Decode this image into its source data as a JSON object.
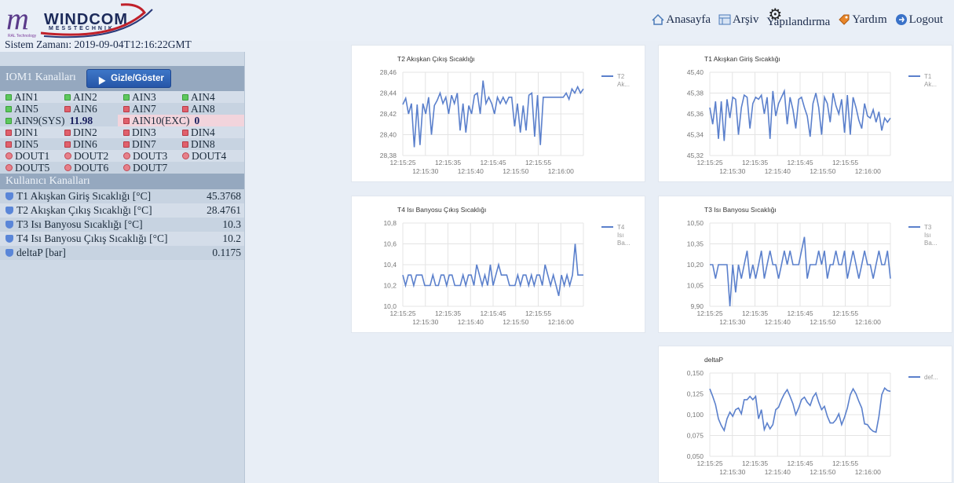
{
  "header": {
    "brand": "WINDCOM",
    "brand_sub": "MESSTECHNIK",
    "brand_tiny": "RAL Technology",
    "brand_mono": "m",
    "nav": [
      {
        "label": "Anasayfa",
        "icon": "home-icon"
      },
      {
        "label": "Arşiv",
        "icon": "archive-icon"
      },
      {
        "label": "Yapılandırma",
        "icon": "gear-icon"
      },
      {
        "label": "Yardım",
        "icon": "help-icon"
      },
      {
        "label": "Logout",
        "icon": "logout-icon"
      }
    ]
  },
  "system_time": "Sistem Zamanı: 2019-09-04T12:16:22GMT",
  "iom": {
    "title": "IOM1 Kanalları",
    "toggle_label": "Gizle/Göster",
    "rows": [
      [
        {
          "label": "AIN1",
          "ind": "green"
        },
        {
          "label": "AIN2",
          "ind": "green"
        },
        {
          "label": "AIN3",
          "ind": "green"
        },
        {
          "label": "AIN4",
          "ind": "green"
        }
      ],
      [
        {
          "label": "AIN5",
          "ind": "green"
        },
        {
          "label": "AIN6",
          "ind": "red"
        },
        {
          "label": "AIN7",
          "ind": "red"
        },
        {
          "label": "AIN8",
          "ind": "red"
        }
      ],
      [
        {
          "label": "DIN1",
          "ind": "red"
        },
        {
          "label": "DIN2",
          "ind": "red"
        },
        {
          "label": "DIN3",
          "ind": "red"
        },
        {
          "label": "DIN4",
          "ind": "red"
        }
      ],
      [
        {
          "label": "DIN5",
          "ind": "red"
        },
        {
          "label": "DIN6",
          "ind": "red"
        },
        {
          "label": "DIN7",
          "ind": "red"
        },
        {
          "label": "DIN8",
          "ind": "red"
        }
      ],
      [
        {
          "label": "DOUT1",
          "ind": "circ"
        },
        {
          "label": "DOUT2",
          "ind": "circ"
        },
        {
          "label": "DOUT3",
          "ind": "circ"
        },
        {
          "label": "DOUT4",
          "ind": "circ"
        }
      ],
      [
        {
          "label": "DOUT5",
          "ind": "circ"
        },
        {
          "label": "DOUT6",
          "ind": "circ"
        },
        {
          "label": "DOUT7",
          "ind": "circ"
        }
      ]
    ],
    "ain9_label": "AIN9(SYS)",
    "ain9_value": "11.98",
    "ain10_label": "AIN10(EXC)",
    "ain10_value": "0"
  },
  "user_channels": {
    "title": "Kullanıcı Kanalları",
    "items": [
      {
        "label": "T1 Akışkan Giriş Sıcaklığı [°C]",
        "value": "45.3768"
      },
      {
        "label": "T2 Akışkan Çıkış Sıcaklığı [°C]",
        "value": "28.4761"
      },
      {
        "label": "T3 Isı Banyosu Sıcaklığı [°C]",
        "value": "10.3"
      },
      {
        "label": "T4 Isı Banyosu Çıkış Sıcaklığı [°C]",
        "value": "10.2"
      },
      {
        "label": "deltaP [bar]",
        "value": "0.1175"
      }
    ]
  },
  "colors": {
    "line": "#5b80cc",
    "grid": "#e4e4e4"
  },
  "chart_data": [
    {
      "type": "line",
      "title": "T2 Akışkan Çıkış Sıcaklığı",
      "legend": [
        "T2",
        "Ak..."
      ],
      "yticks": [
        "28,46",
        "28,44",
        "28,42",
        "28,40",
        "28,38"
      ],
      "ylim": [
        28.38,
        28.46
      ],
      "xticks_top": [
        "12:15:25",
        "12:15:35",
        "12:15:45",
        "12:15:55"
      ],
      "xticks_bottom": [
        "12:15:30",
        "12:15:40",
        "12:15:50",
        "12:16:00"
      ],
      "series": [
        {
          "values": [
            28.429,
            28.435,
            28.42,
            28.43,
            28.388,
            28.429,
            28.39,
            28.43,
            28.42,
            28.436,
            28.4,
            28.428,
            28.433,
            28.44,
            28.43,
            28.436,
            28.42,
            28.438,
            28.43,
            28.44,
            28.404,
            28.43,
            28.402,
            28.428,
            28.42,
            28.438,
            28.44,
            28.42,
            28.452,
            28.43,
            28.436,
            28.43,
            28.42,
            28.436,
            28.43,
            28.436,
            28.43,
            28.436,
            28.436,
            28.408,
            28.43,
            28.402,
            28.428,
            28.404,
            28.438,
            28.44,
            28.398,
            28.438,
            28.39,
            28.436,
            28.436,
            28.436,
            28.436,
            28.436,
            28.436,
            28.436,
            28.436,
            28.44,
            28.434,
            28.444,
            28.44,
            28.446,
            28.44,
            28.444
          ]
        }
      ]
    },
    {
      "type": "line",
      "title": "T1 Akışkan Giriş Sıcaklığı",
      "legend": [
        "T1",
        "Ak..."
      ],
      "yticks": [
        "45,40",
        "45,38",
        "45,36",
        "45,34",
        "45,32"
      ],
      "ylim": [
        45.32,
        45.4
      ],
      "xticks_top": [
        "12:15:25",
        "12:15:35",
        "12:15:45",
        "12:15:55"
      ],
      "xticks_bottom": [
        "12:15:30",
        "12:15:40",
        "12:15:50",
        "12:16:00"
      ],
      "series": [
        {
          "values": [
            45.366,
            45.35,
            45.372,
            45.336,
            45.372,
            45.334,
            45.374,
            45.356,
            45.376,
            45.374,
            45.34,
            45.366,
            45.378,
            45.376,
            45.346,
            45.37,
            45.376,
            45.374,
            45.378,
            45.36,
            45.376,
            45.336,
            45.382,
            45.358,
            45.37,
            45.376,
            45.382,
            45.35,
            45.376,
            45.364,
            45.346,
            45.374,
            45.376,
            45.366,
            45.358,
            45.338,
            45.37,
            45.38,
            45.366,
            45.34,
            45.376,
            45.37,
            45.352,
            45.38,
            45.368,
            45.36,
            45.374,
            45.342,
            45.378,
            45.34,
            45.376,
            45.366,
            45.354,
            45.346,
            45.37,
            45.358,
            45.356,
            45.364,
            45.352,
            45.362,
            45.344,
            45.356,
            45.352,
            45.356
          ]
        }
      ]
    },
    {
      "type": "line",
      "title": "T4 Isı Banyosu Çıkış Sıcaklığı",
      "legend": [
        "T4",
        "Isı",
        "Ba..."
      ],
      "yticks": [
        "10,8",
        "10,6",
        "10,4",
        "10,2",
        "10,0"
      ],
      "ylim": [
        10.0,
        10.8
      ],
      "xticks_top": [
        "12:15:25",
        "12:15:35",
        "12:15:45",
        "12:15:55"
      ],
      "xticks_bottom": [
        "12:15:30",
        "12:15:40",
        "12:15:50",
        "12:16:00"
      ],
      "series": [
        {
          "values": [
            10.3,
            10.2,
            10.3,
            10.3,
            10.2,
            10.3,
            10.3,
            10.3,
            10.2,
            10.2,
            10.2,
            10.3,
            10.2,
            10.2,
            10.3,
            10.3,
            10.2,
            10.3,
            10.3,
            10.2,
            10.2,
            10.2,
            10.3,
            10.2,
            10.3,
            10.3,
            10.2,
            10.4,
            10.3,
            10.2,
            10.3,
            10.2,
            10.4,
            10.2,
            10.3,
            10.4,
            10.3,
            10.3,
            10.3,
            10.2,
            10.2,
            10.2,
            10.3,
            10.2,
            10.3,
            10.3,
            10.2,
            10.3,
            10.2,
            10.3,
            10.3,
            10.2,
            10.4,
            10.3,
            10.2,
            10.3,
            10.2,
            10.1,
            10.3,
            10.2,
            10.3,
            10.2,
            10.3,
            10.6,
            10.3,
            10.3,
            10.3
          ]
        }
      ]
    },
    {
      "type": "line",
      "title": "T3 Isı Banyosu Sıcaklığı",
      "legend": [
        "T3",
        "Isı",
        "Ba..."
      ],
      "yticks": [
        "10,50",
        "10,35",
        "10,20",
        "10,05",
        "9,90"
      ],
      "ylim": [
        9.9,
        10.5
      ],
      "xticks_top": [
        "12:15:25",
        "12:15:35",
        "12:15:45",
        "12:15:55"
      ],
      "xticks_bottom": [
        "12:15:30",
        "12:15:40",
        "12:15:50",
        "12:16:00"
      ],
      "series": [
        {
          "values": [
            10.2,
            10.2,
            10.1,
            10.2,
            10.2,
            10.2,
            10.2,
            9.9,
            10.2,
            10.0,
            10.2,
            10.1,
            10.2,
            10.3,
            10.1,
            10.2,
            10.1,
            10.2,
            10.3,
            10.1,
            10.2,
            10.3,
            10.2,
            10.2,
            10.1,
            10.2,
            10.3,
            10.2,
            10.3,
            10.2,
            10.2,
            10.2,
            10.3,
            10.4,
            10.1,
            10.2,
            10.2,
            10.2,
            10.3,
            10.2,
            10.3,
            10.1,
            10.2,
            10.2,
            10.3,
            10.2,
            10.2,
            10.3,
            10.1,
            10.2,
            10.3,
            10.2,
            10.1,
            10.2,
            10.3,
            10.2,
            10.2,
            10.1,
            10.2,
            10.3,
            10.2,
            10.2,
            10.3,
            10.1
          ]
        }
      ]
    },
    {
      "type": "line",
      "title": "deltaP",
      "legend": [
        "def..."
      ],
      "yticks": [
        "0,150",
        "0,125",
        "0,100",
        "0,075",
        "0,050"
      ],
      "ylim": [
        0.05,
        0.15
      ],
      "xticks_top": [
        "12:15:25",
        "12:15:35",
        "12:15:45",
        "12:15:55"
      ],
      "xticks_bottom": [
        "12:15:30",
        "12:15:40",
        "12:15:50",
        "12:16:00"
      ],
      "series": [
        {
          "values": [
            0.131,
            0.122,
            0.112,
            0.095,
            0.087,
            0.081,
            0.095,
            0.103,
            0.098,
            0.106,
            0.108,
            0.101,
            0.118,
            0.118,
            0.122,
            0.118,
            0.122,
            0.095,
            0.106,
            0.082,
            0.09,
            0.083,
            0.088,
            0.106,
            0.109,
            0.118,
            0.125,
            0.13,
            0.122,
            0.113,
            0.1,
            0.108,
            0.118,
            0.121,
            0.115,
            0.111,
            0.121,
            0.126,
            0.115,
            0.106,
            0.11,
            0.098,
            0.09,
            0.09,
            0.094,
            0.101,
            0.088,
            0.097,
            0.108,
            0.124,
            0.131,
            0.125,
            0.116,
            0.108,
            0.089,
            0.088,
            0.083,
            0.08,
            0.079,
            0.098,
            0.124,
            0.132,
            0.129,
            0.128
          ]
        }
      ]
    }
  ]
}
